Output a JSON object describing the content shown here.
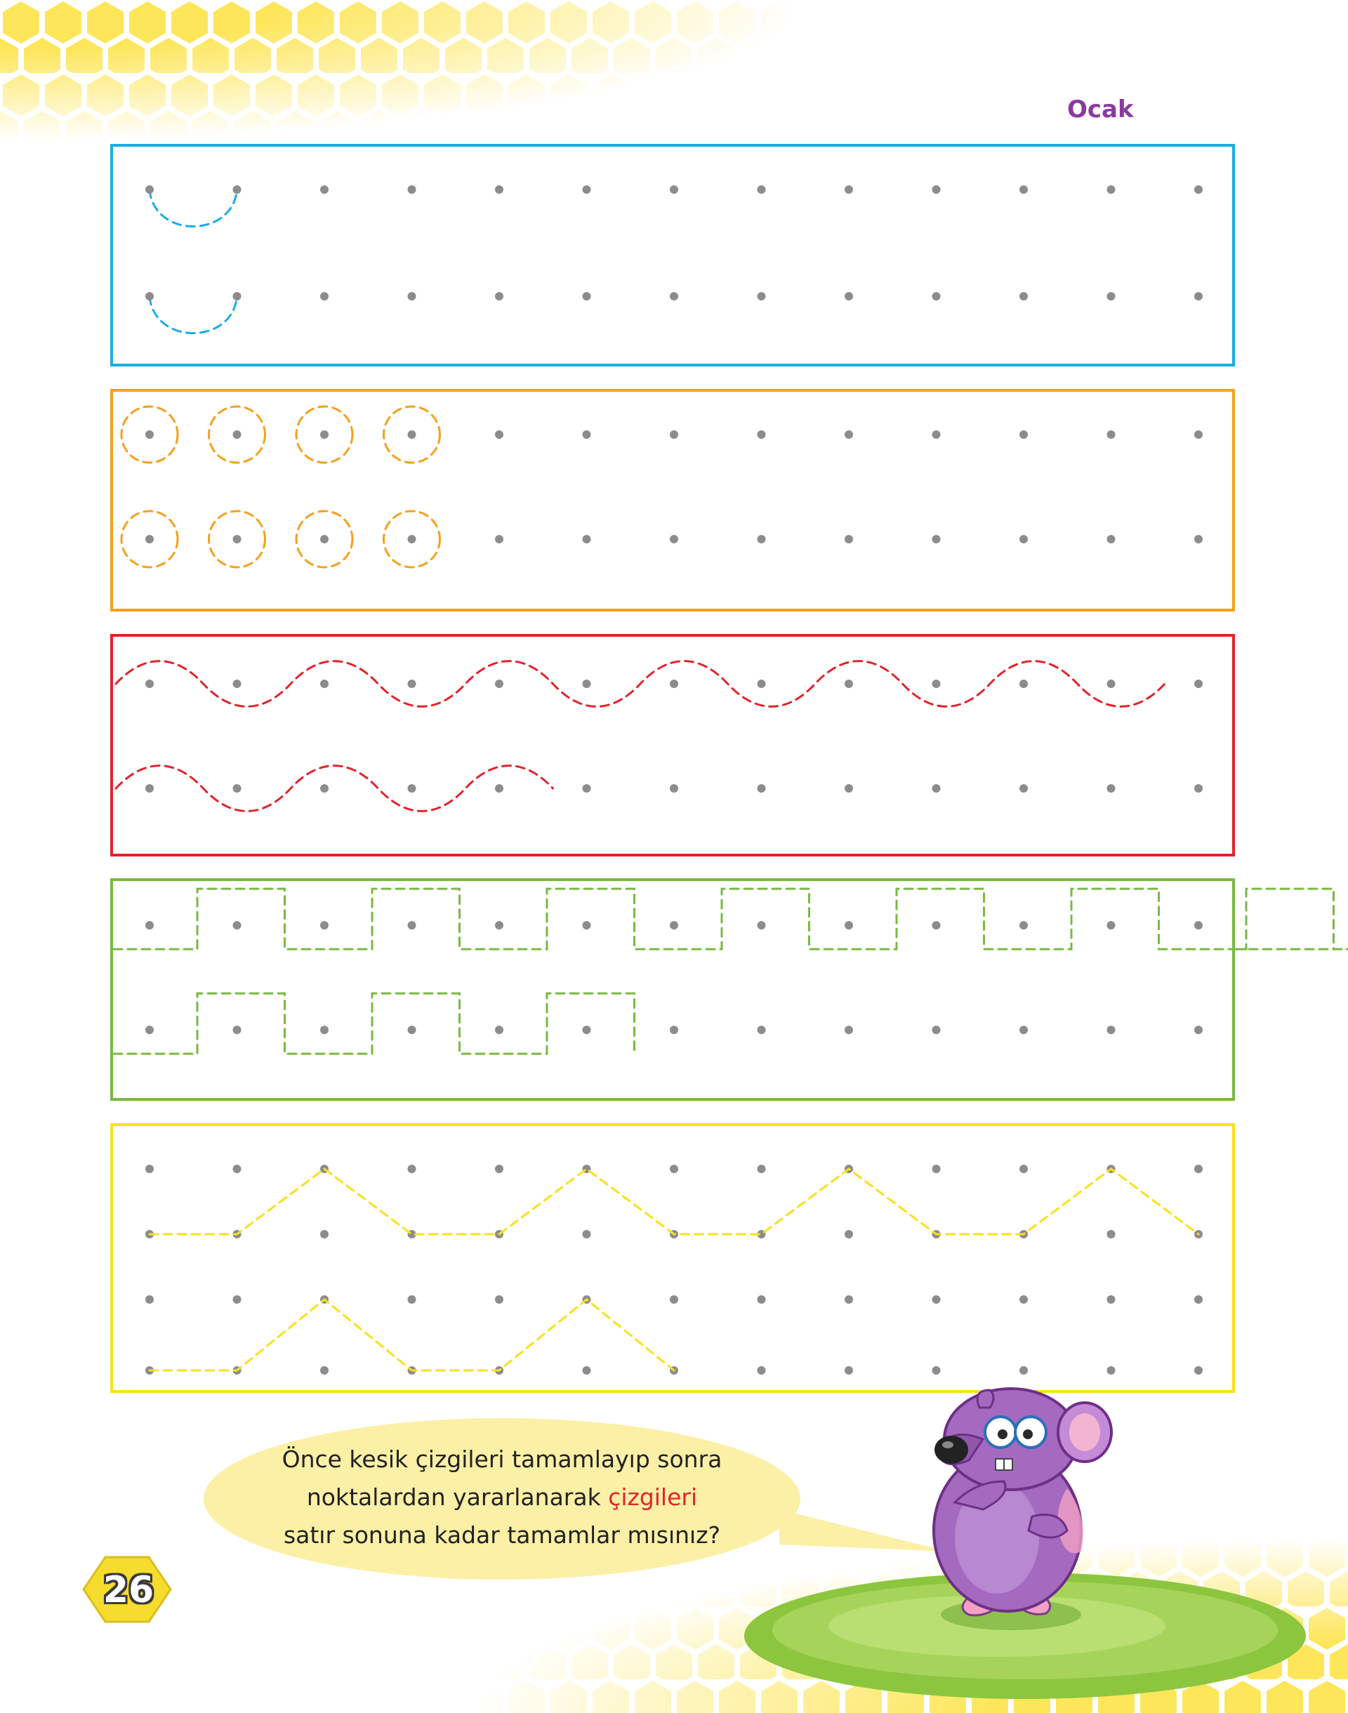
{
  "header": {
    "month": "Ocak"
  },
  "instruction": {
    "line1": "Önce kesik çizgileri tamamlayıp sonra",
    "line2_before": "noktalardan yararlanarak ",
    "line2_highlight": "çizgileri",
    "line3": "satır sonuna kadar tamamlar mısınız?"
  },
  "page_number": "26",
  "colors": {
    "blue": "#1aaee3",
    "orange": "#f4a020",
    "red": "#e0242b",
    "green": "#7ab843",
    "yellow": "#f8e11d",
    "dot": "#8c8c8c",
    "honeycomb": "#fde65a",
    "bubble": "#fbf0a6",
    "month": "#8a3aa0",
    "highlight": "#e0242b"
  },
  "exercises": [
    {
      "pattern": "cup-arcs",
      "color": "blue",
      "rows": 2
    },
    {
      "pattern": "circles",
      "color": "orange",
      "rows": 2
    },
    {
      "pattern": "waves",
      "color": "red",
      "rows": 2
    },
    {
      "pattern": "square-wave",
      "color": "green",
      "rows": 2
    },
    {
      "pattern": "zigzag-plateau",
      "color": "yellow",
      "rows": 2
    }
  ],
  "icons": [
    "honeycomb-pattern",
    "mouse-character",
    "grass-patch",
    "hexagon-badge"
  ]
}
